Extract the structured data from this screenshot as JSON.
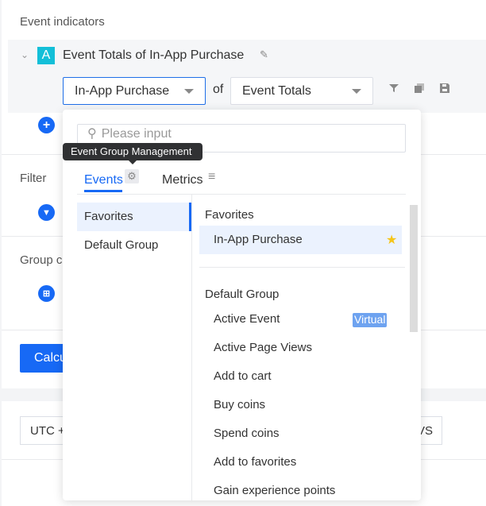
{
  "section_title": "Event indicators",
  "indicator": {
    "badge": "A",
    "title": "Event Totals of In-App Purchase",
    "event_select": "In-App Purchase",
    "of_label": "of",
    "metric_select": "Event Totals"
  },
  "filter_label": "Filter",
  "group_label": "Group c",
  "calculate_label": "Calcu",
  "timezone_label": "UTC +",
  "vs_label": "VS",
  "dropdown": {
    "search_placeholder": "Please input",
    "tooltip": "Event Group Management",
    "tabs": [
      {
        "label": "Events"
      },
      {
        "label": "Metrics"
      }
    ],
    "groups": [
      {
        "label": "Favorites"
      },
      {
        "label": "Default Group"
      }
    ],
    "favorites_header": "Favorites",
    "favorites": [
      {
        "label": "In-App Purchase"
      }
    ],
    "default_header": "Default Group",
    "virtual_badge": "Virtual",
    "events": [
      {
        "label": "Active Event"
      },
      {
        "label": "Active Page Views"
      },
      {
        "label": "Add to cart"
      },
      {
        "label": "Buy coins"
      },
      {
        "label": "Spend coins"
      },
      {
        "label": "Add to favorites"
      },
      {
        "label": "Gain experience points"
      }
    ]
  },
  "colors": {
    "accent": "#1769f5",
    "badge": "#13bfd8",
    "star": "#f5c518",
    "virtual": "#6ea3f0"
  }
}
